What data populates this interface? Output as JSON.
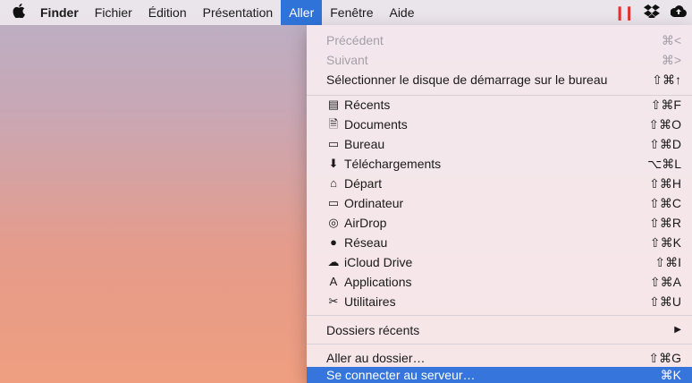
{
  "menubar": {
    "apple_icon": "apple-icon",
    "items": [
      {
        "label": "Finder"
      },
      {
        "label": "Fichier"
      },
      {
        "label": "Édition"
      },
      {
        "label": "Présentation"
      },
      {
        "label": "Aller"
      },
      {
        "label": "Fenêtre"
      },
      {
        "label": "Aide"
      }
    ],
    "active_item": "Aller"
  },
  "menu": {
    "history": [
      {
        "label": "Précédent",
        "shortcut": "⌘<"
      },
      {
        "label": "Suivant",
        "shortcut": "⌘>"
      },
      {
        "label": "Sélectionner le disque de démarrage sur le bureau",
        "shortcut": "⇧⌘↑"
      }
    ],
    "places": [
      {
        "label": "Récents",
        "shortcut": "⇧⌘F",
        "icon": "recents-icon"
      },
      {
        "label": "Documents",
        "shortcut": "⇧⌘O",
        "icon": "documents-icon"
      },
      {
        "label": "Bureau",
        "shortcut": "⇧⌘D",
        "icon": "desktop-icon"
      },
      {
        "label": "Téléchargements",
        "shortcut": "⌥⌘L",
        "icon": "downloads-icon"
      },
      {
        "label": "Départ",
        "shortcut": "⇧⌘H",
        "icon": "home-icon"
      },
      {
        "label": "Ordinateur",
        "shortcut": "⇧⌘C",
        "icon": "computer-icon"
      },
      {
        "label": "AirDrop",
        "shortcut": "⇧⌘R",
        "icon": "airdrop-icon"
      },
      {
        "label": "Réseau",
        "shortcut": "⇧⌘K",
        "icon": "network-icon"
      },
      {
        "label": "iCloud Drive",
        "shortcut": "⇧⌘I",
        "icon": "icloud-icon"
      },
      {
        "label": "Applications",
        "shortcut": "⇧⌘A",
        "icon": "applications-icon"
      },
      {
        "label": "Utilitaires",
        "shortcut": "⇧⌘U",
        "icon": "utilities-icon"
      }
    ],
    "recent_folders": {
      "label": "Dossiers récents",
      "arrow": "▶"
    },
    "goto": {
      "label": "Aller au dossier…",
      "shortcut": "⇧⌘G"
    },
    "connect": {
      "label": "Se connecter au serveur…",
      "shortcut": "⌘K"
    }
  },
  "colors": {
    "highlight": "#3575dc",
    "pause": "#e0332d"
  }
}
